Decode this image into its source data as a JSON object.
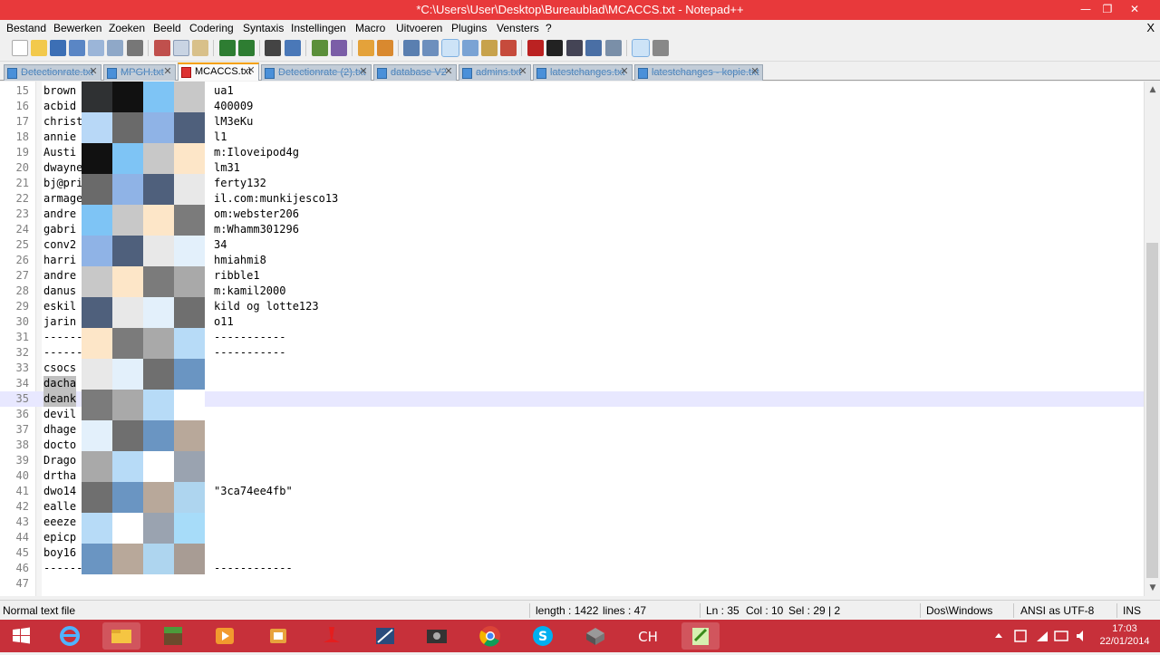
{
  "window": {
    "title": "*C:\\Users\\User\\Desktop\\Bureaublad\\MCACCS.txt - Notepad++",
    "minimize_icon": "—",
    "restore_icon": "❐",
    "close_icon": "✕"
  },
  "menu": {
    "items": [
      "Bestand",
      "Bewerken",
      "Zoeken",
      "Beeld",
      "Codering",
      "Syntaxis",
      "Instellingen",
      "Macro",
      "Uitvoeren",
      "Plugins",
      "Vensters",
      "?"
    ],
    "close_doc": "X"
  },
  "tabs": [
    {
      "label": "Detectionrate.txt",
      "active": false
    },
    {
      "label": "MPGH.txt",
      "active": false
    },
    {
      "label": "MCACCS.txt",
      "active": true
    },
    {
      "label": "Detectionrate (2).txt",
      "active": false
    },
    {
      "label": "database V2",
      "active": false
    },
    {
      "label": "admins.txt",
      "active": false
    },
    {
      "label": "latestchanges.txt",
      "active": false
    },
    {
      "label": "latestchanges - kopie.txt",
      "active": false
    }
  ],
  "editor": {
    "current_line": 35,
    "lines": [
      {
        "n": "15",
        "left": "brown",
        "right": "ua1"
      },
      {
        "n": "16",
        "left": "acbid",
        "right": "400009"
      },
      {
        "n": "17",
        "left": "christ",
        "right": "lM3eKu"
      },
      {
        "n": "18",
        "left": "annie",
        "right": "l1"
      },
      {
        "n": "19",
        "left": "Austi",
        "right": "m:Iloveipod4g"
      },
      {
        "n": "20",
        "left": "dwayne",
        "right": "lm31"
      },
      {
        "n": "21",
        "left": "bj@pri",
        "right": "ferty132"
      },
      {
        "n": "22",
        "left": "armage",
        "right": "il.com:munkijesco13"
      },
      {
        "n": "23",
        "left": "andre",
        "right": "om:webster206"
      },
      {
        "n": "24",
        "left": "gabri",
        "right": "m:Whamm301296"
      },
      {
        "n": "25",
        "left": "conv2",
        "right": "34"
      },
      {
        "n": "26",
        "left": "harri",
        "right": "hmiahmi8"
      },
      {
        "n": "27",
        "left": "andre",
        "right": "ribble1"
      },
      {
        "n": "28",
        "left": "danus",
        "right": "m:kamil2000"
      },
      {
        "n": "29",
        "left": "eskil",
        "right": "kild og lotte123"
      },
      {
        "n": "30",
        "left": "jarin",
        "right": "o11"
      },
      {
        "n": "31",
        "left": "------",
        "right": "-----------"
      },
      {
        "n": "32",
        "left": "------",
        "right": "-----------"
      },
      {
        "n": "33",
        "left": "csocs",
        "right": ""
      },
      {
        "n": "34",
        "left": "dacha",
        "right": ""
      },
      {
        "n": "35",
        "left": "deank",
        "right": ""
      },
      {
        "n": "36",
        "left": "devil",
        "right": ""
      },
      {
        "n": "37",
        "left": "dhage",
        "right": ""
      },
      {
        "n": "38",
        "left": "docto",
        "right": ""
      },
      {
        "n": "39",
        "left": "Drago",
        "right": ""
      },
      {
        "n": "40",
        "left": "drtha",
        "right": ""
      },
      {
        "n": "41",
        "left": "dwo14",
        "right": "\"3ca74ee4fb\""
      },
      {
        "n": "42",
        "left": "ealle",
        "right": ""
      },
      {
        "n": "43",
        "left": "eeeze",
        "right": ""
      },
      {
        "n": "44",
        "left": "epicp",
        "right": ""
      },
      {
        "n": "45",
        "left": "boy16",
        "right": ""
      },
      {
        "n": "46",
        "left": "------",
        "right": "------------"
      },
      {
        "n": "47",
        "left": "",
        "right": ""
      }
    ]
  },
  "status": {
    "file_type": "Normal text file",
    "length": "length : 1422",
    "lines": "lines : 47",
    "ln": "Ln : 35",
    "col": "Col : 10",
    "sel": "Sel : 29 | 2",
    "eol": "Dos\\Windows",
    "encoding": "ANSI as UTF-8",
    "mode": "INS"
  },
  "taskbar": {
    "time": "17:03",
    "date": "22/01/2014",
    "apps": [
      "windows-start-icon",
      "internet-explorer-icon",
      "file-explorer-icon",
      "minecraft-icon",
      "media-player-icon",
      "app-icon-5",
      "app-icon-6",
      "app-icon-7",
      "video-icon",
      "chrome-icon",
      "skype-icon",
      "app-icon-11",
      "ch-app-icon",
      "notepadpp-icon"
    ]
  }
}
